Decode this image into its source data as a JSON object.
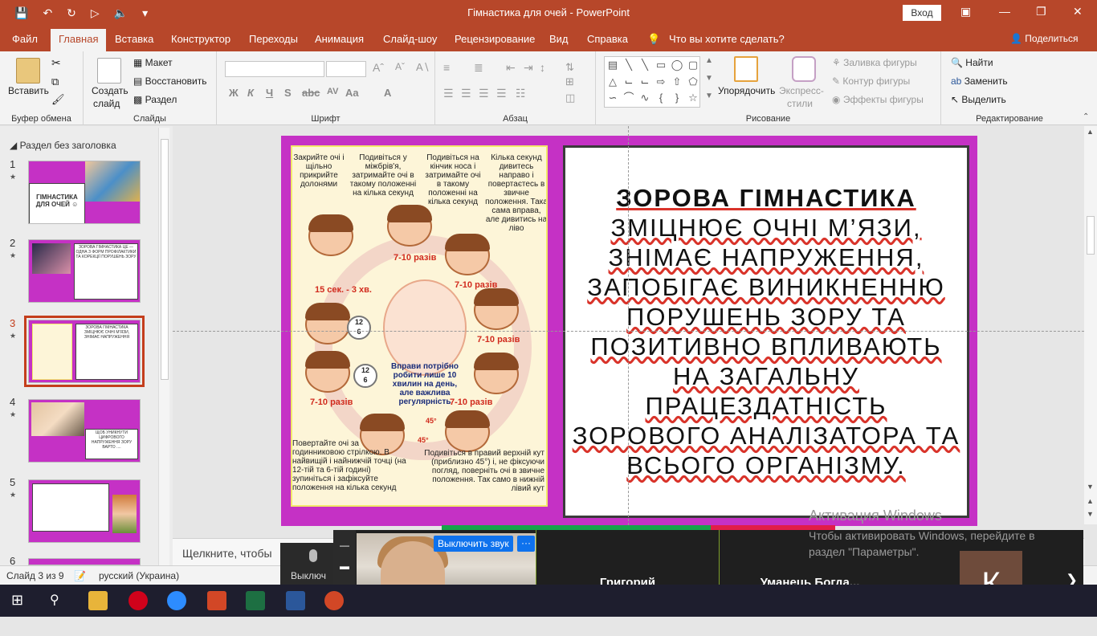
{
  "titlebar": {
    "title": "Гімнастика для очей  -  PowerPoint",
    "signin": "Вход",
    "undo_icon": "undo-icon",
    "redo_icon": "redo-icon"
  },
  "tabs": [
    "Файл",
    "Главная",
    "Вставка",
    "Конструктор",
    "Переходы",
    "Анимация",
    "Слайд-шоу",
    "Рецензирование",
    "Вид",
    "Справка",
    "Что вы хотите сделать?"
  ],
  "share": "Поделиться",
  "ribbon": {
    "clipboard": {
      "paste": "Вставить",
      "label": "Буфер обмена"
    },
    "slides": {
      "new_slide": "Создать",
      "new_slide2": "слайд",
      "layout": "Макет",
      "reset": "Восстановить",
      "section": "Раздел",
      "label": "Слайды"
    },
    "font": {
      "label": "Шрифт"
    },
    "paragraph": {
      "label": "Абзац"
    },
    "drawing": {
      "arrange": "Упорядочить",
      "quick_styles": "Экспресс-",
      "quick_styles2": "стили",
      "fill": "Заливка фигуры",
      "outline": "Контур фигуры",
      "effects": "Эффекты фигуры",
      "label": "Рисование"
    },
    "editing": {
      "find": "Найти",
      "replace": "Заменить",
      "select": "Выделить",
      "label": "Редактирование"
    }
  },
  "thumbs": {
    "section": "Раздел без заголовка",
    "items": [
      {
        "num": "1",
        "text": "ГІМНАСТИКА ДЛЯ ОЧЕЙ ☺"
      },
      {
        "num": "2",
        "text": "ЗОРОВА ГІМНАСТИКА ЦЕ — ОДНА З ФОРМ ПРОФІЛАКТИКИ ТА КОРЕКЦІЇ ПОРУШЕНЬ ЗОРУ"
      },
      {
        "num": "3",
        "text": "ЗОРОВА ГІМНАСТИКА ЗМІЦНЮЄ ОЧНІ М'ЯЗИ, ЗНІМАЄ НАПРУЖЕННЯ"
      },
      {
        "num": "4",
        "text": "ЩОБ УНИКНУТИ ЦИФРОВОГО НАПРУЖЕННЯ ЗОРУ ВАРТО ...."
      },
      {
        "num": "5",
        "text": ""
      },
      {
        "num": "6",
        "text": ""
      }
    ]
  },
  "slide": {
    "heading": "ЗОРОВА ГІМНАСТИКА",
    "body": "ЗМІЦНЮЄ ОЧНІ М’ЯЗИ, ЗНІМАЄ НАПРУЖЕННЯ, ЗАПОБІГАЄ ВИНИКНЕННЮ ПОРУШЕНЬ ЗОРУ ТА ПОЗИТИВНО ВПЛИВАЮТЬ НА ЗАГАЛЬНУ ПРАЦЕЗДАТНІСТЬ ЗОРОВОГО АНАЛІЗАТОРА ТА ВСЬОГО ОРГАНІЗМУ.",
    "infographic": {
      "step1": "Закрийте очі і щільно прикрийте долонями",
      "step2": "Подивіться у міжбрів'я, затримайте очі в такому положенні на кілька секунд",
      "step3": "Подивіться на кінчик носа і затримайте очі в такому положенні на кілька секунд",
      "step4": "Кілька секунд дивитесь направо і повертаєтесь в звичне положення. Така сама вправа, але дивитись на ліво",
      "time": "15 сек. - 3 хв.",
      "reps": "7-10 разів",
      "tip": "Вправи потрібно робити лише 10 хвилин на день, але важлива регулярність",
      "clock_top": "12",
      "clock_bottom": "6",
      "angle": "45°",
      "step5": "Повертайте очі за годинниковою стрілкою. В найвищій і найнижчій точці (на 12-тій та 6-тій годині) зупиніться і зафіксуйте положення на кілька секунд",
      "step6": "Подивіться в правий верхній кут (приблизно 45°) і, не фіксуючи погляд, поверніть очі в звичне положення. Так само в нижній лівий кут"
    }
  },
  "notes_placeholder": "Щелкните, чтобы",
  "activation": {
    "title": "Активация Windows",
    "text": "Чтобы активировать Windows, перейдите в раздел \"Параметры\"."
  },
  "status": {
    "slide": "Слайд 3 из 9",
    "lang": "русский (Украина)"
  },
  "zoom": {
    "mute_label": "Выключить звук",
    "more": "···",
    "participants": [
      "Григорий",
      "Уманець  Богда..."
    ],
    "avatar_letter": "К",
    "mic_label": "Выключ"
  }
}
